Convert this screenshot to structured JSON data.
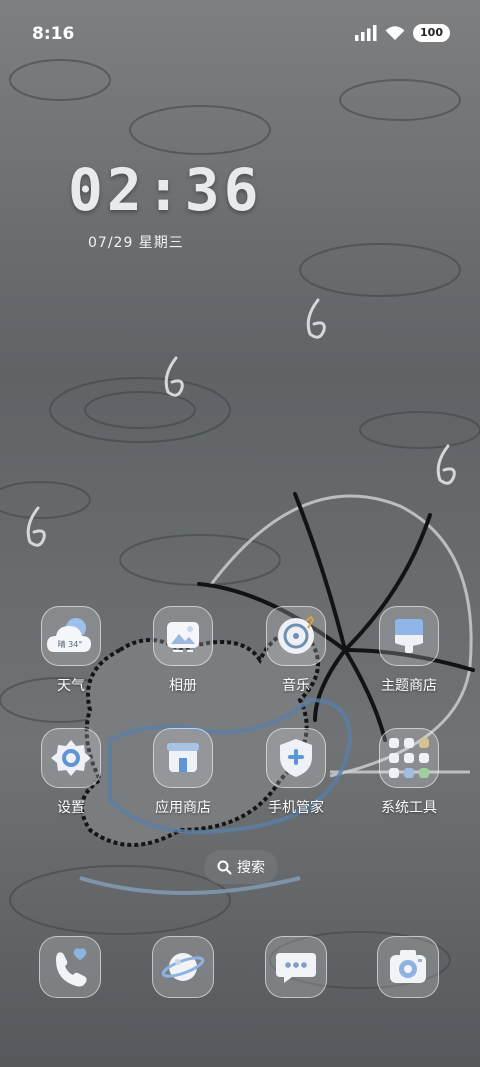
{
  "status_bar": {
    "time": "8:16",
    "battery": "100"
  },
  "lock_clock": {
    "time": "02:36",
    "date": "07/29  星期三"
  },
  "weather_icon_text": "晴 34°",
  "apps": [
    {
      "name": "weather",
      "label": "天气",
      "icon": "weather-icon"
    },
    {
      "name": "gallery",
      "label": "相册",
      "icon": "gallery-icon"
    },
    {
      "name": "music",
      "label": "音乐",
      "icon": "music-icon"
    },
    {
      "name": "theme-store",
      "label": "主题商店",
      "icon": "theme-store-icon"
    },
    {
      "name": "settings",
      "label": "设置",
      "icon": "settings-icon"
    },
    {
      "name": "app-store",
      "label": "应用商店",
      "icon": "app-store-icon"
    },
    {
      "name": "phone-manager",
      "label": "手机管家",
      "icon": "shield-icon"
    },
    {
      "name": "system-tools",
      "label": "系统工具",
      "icon": "folder-icon"
    }
  ],
  "search": {
    "label": "搜索"
  },
  "dock": [
    {
      "name": "phone",
      "icon": "phone-icon"
    },
    {
      "name": "browser",
      "icon": "browser-icon"
    },
    {
      "name": "messages",
      "icon": "messages-icon"
    },
    {
      "name": "camera",
      "icon": "camera-icon"
    }
  ],
  "colors": {
    "accent_blue": "#5a8fd0",
    "light_blue": "#a9c7ee"
  }
}
